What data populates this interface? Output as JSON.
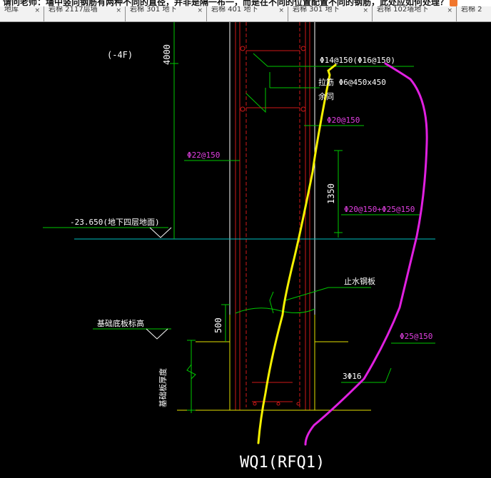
{
  "question": {
    "text": "请问老师：墙中竖向钢筋有两种不同的直径，并非是隔一布一，而是在不同的位置配置不同的钢筋，此处应如何处理？"
  },
  "tabs": [
    {
      "label": "地库",
      "close": "×"
    },
    {
      "label": "岩棉 2117层墙",
      "close": "×"
    },
    {
      "label": "岩棉 301 地下",
      "close": "×"
    },
    {
      "label": "岩棉 401 地下",
      "close": "×"
    },
    {
      "label": "岩棉 301 地下",
      "close": "×"
    },
    {
      "label": "岩棉 102墙地下",
      "close": "×"
    },
    {
      "label": "岩棉 2",
      "close": ""
    }
  ],
  "drawing": {
    "floor_label": "(-4F)",
    "dim_height": "4000",
    "rebar_top": "Φ14@150(Φ16@150)",
    "tie_bar": "拉筋 Φ6@450x450",
    "tie_bar_note": "余同",
    "rebar_upper": "Φ20@150",
    "rebar_left": "Φ22@150",
    "dim_lap": "1350",
    "rebar_lower": "Φ20@150+Φ25@150",
    "elevation": "-23.650(地下四层地面)",
    "waterstop": "止水钢板",
    "slab_top": "基础底板标高",
    "dim_500": "500",
    "rebar_bottom": "Φ25@150",
    "anchorage": "基础板厚度",
    "bottom_bars": "3Φ16",
    "wall_name": "WQ1(RFQ1)",
    "colors": {
      "green": "#00c800",
      "magenta": "#e040e0",
      "red": "#d01818",
      "cyan": "#00bfbf",
      "yellow": "#f4f000",
      "annotation_magenta": "#e020e0",
      "white": "#ffffff"
    }
  }
}
